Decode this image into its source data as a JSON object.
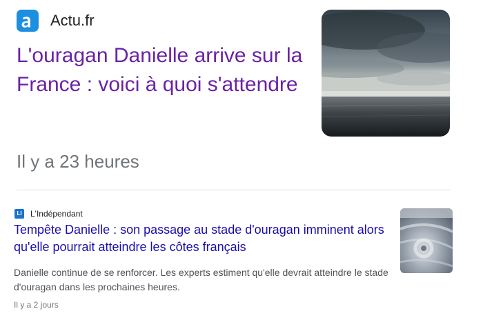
{
  "articles": [
    {
      "source": "Actu.fr",
      "logo_letter": "a",
      "title": "L'ouragan Danielle arrive sur la France : voici à quoi s'attendre",
      "time": "Il y a 23 heures",
      "image": "stormy-sea-photo"
    },
    {
      "source": "L'Indépendant",
      "logo_letter": "LI",
      "title": "Tempête Danielle : son passage au stade d'ouragan imminent alors qu'elle pourrait atteindre les côtes français",
      "snippet": "Danielle continue de se renforcer. Les experts estiment qu'elle devrait atteindre le stade d'ouragan dans les prochaines heures.",
      "time": "Il y a 2 jours",
      "image": "satellite-hurricane-photo"
    }
  ],
  "colors": {
    "actu_logo": "#1d8fe0",
    "independant_logo": "#1d73c9",
    "visited_link": "#6a22a5",
    "link": "#1a0dab",
    "meta_text": "#70757a",
    "snippet_text": "#4d5156"
  }
}
